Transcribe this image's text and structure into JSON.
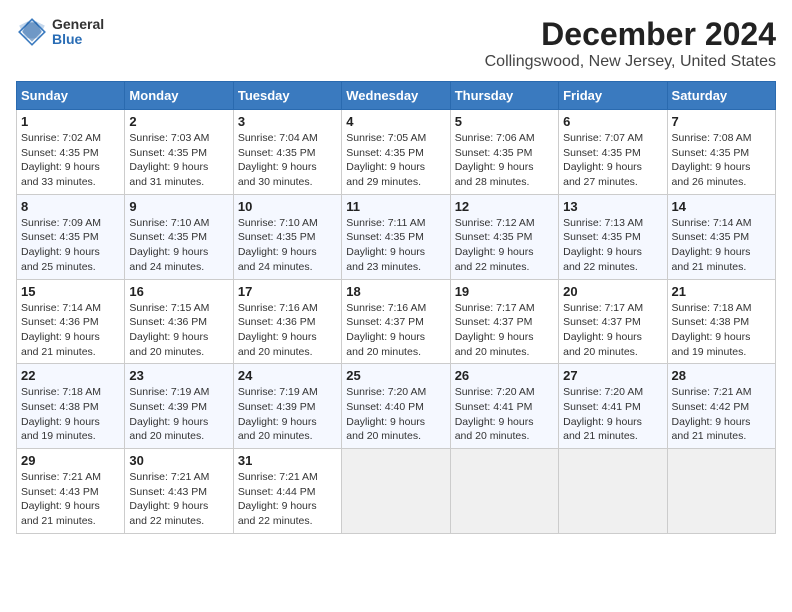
{
  "app": {
    "name": "GeneralBlue",
    "logo_text_line1": "General",
    "logo_text_line2": "Blue"
  },
  "title": "December 2024",
  "subtitle": "Collingswood, New Jersey, United States",
  "calendar": {
    "headers": [
      "Sunday",
      "Monday",
      "Tuesday",
      "Wednesday",
      "Thursday",
      "Friday",
      "Saturday"
    ],
    "weeks": [
      [
        {
          "day": "1",
          "info": "Sunrise: 7:02 AM\nSunset: 4:35 PM\nDaylight: 9 hours\nand 33 minutes."
        },
        {
          "day": "2",
          "info": "Sunrise: 7:03 AM\nSunset: 4:35 PM\nDaylight: 9 hours\nand 31 minutes."
        },
        {
          "day": "3",
          "info": "Sunrise: 7:04 AM\nSunset: 4:35 PM\nDaylight: 9 hours\nand 30 minutes."
        },
        {
          "day": "4",
          "info": "Sunrise: 7:05 AM\nSunset: 4:35 PM\nDaylight: 9 hours\nand 29 minutes."
        },
        {
          "day": "5",
          "info": "Sunrise: 7:06 AM\nSunset: 4:35 PM\nDaylight: 9 hours\nand 28 minutes."
        },
        {
          "day": "6",
          "info": "Sunrise: 7:07 AM\nSunset: 4:35 PM\nDaylight: 9 hours\nand 27 minutes."
        },
        {
          "day": "7",
          "info": "Sunrise: 7:08 AM\nSunset: 4:35 PM\nDaylight: 9 hours\nand 26 minutes."
        }
      ],
      [
        {
          "day": "8",
          "info": "Sunrise: 7:09 AM\nSunset: 4:35 PM\nDaylight: 9 hours\nand 25 minutes."
        },
        {
          "day": "9",
          "info": "Sunrise: 7:10 AM\nSunset: 4:35 PM\nDaylight: 9 hours\nand 24 minutes."
        },
        {
          "day": "10",
          "info": "Sunrise: 7:10 AM\nSunset: 4:35 PM\nDaylight: 9 hours\nand 24 minutes."
        },
        {
          "day": "11",
          "info": "Sunrise: 7:11 AM\nSunset: 4:35 PM\nDaylight: 9 hours\nand 23 minutes."
        },
        {
          "day": "12",
          "info": "Sunrise: 7:12 AM\nSunset: 4:35 PM\nDaylight: 9 hours\nand 22 minutes."
        },
        {
          "day": "13",
          "info": "Sunrise: 7:13 AM\nSunset: 4:35 PM\nDaylight: 9 hours\nand 22 minutes."
        },
        {
          "day": "14",
          "info": "Sunrise: 7:14 AM\nSunset: 4:35 PM\nDaylight: 9 hours\nand 21 minutes."
        }
      ],
      [
        {
          "day": "15",
          "info": "Sunrise: 7:14 AM\nSunset: 4:36 PM\nDaylight: 9 hours\nand 21 minutes."
        },
        {
          "day": "16",
          "info": "Sunrise: 7:15 AM\nSunset: 4:36 PM\nDaylight: 9 hours\nand 20 minutes."
        },
        {
          "day": "17",
          "info": "Sunrise: 7:16 AM\nSunset: 4:36 PM\nDaylight: 9 hours\nand 20 minutes."
        },
        {
          "day": "18",
          "info": "Sunrise: 7:16 AM\nSunset: 4:37 PM\nDaylight: 9 hours\nand 20 minutes."
        },
        {
          "day": "19",
          "info": "Sunrise: 7:17 AM\nSunset: 4:37 PM\nDaylight: 9 hours\nand 20 minutes."
        },
        {
          "day": "20",
          "info": "Sunrise: 7:17 AM\nSunset: 4:37 PM\nDaylight: 9 hours\nand 20 minutes."
        },
        {
          "day": "21",
          "info": "Sunrise: 7:18 AM\nSunset: 4:38 PM\nDaylight: 9 hours\nand 19 minutes."
        }
      ],
      [
        {
          "day": "22",
          "info": "Sunrise: 7:18 AM\nSunset: 4:38 PM\nDaylight: 9 hours\nand 19 minutes."
        },
        {
          "day": "23",
          "info": "Sunrise: 7:19 AM\nSunset: 4:39 PM\nDaylight: 9 hours\nand 20 minutes."
        },
        {
          "day": "24",
          "info": "Sunrise: 7:19 AM\nSunset: 4:39 PM\nDaylight: 9 hours\nand 20 minutes."
        },
        {
          "day": "25",
          "info": "Sunrise: 7:20 AM\nSunset: 4:40 PM\nDaylight: 9 hours\nand 20 minutes."
        },
        {
          "day": "26",
          "info": "Sunrise: 7:20 AM\nSunset: 4:41 PM\nDaylight: 9 hours\nand 20 minutes."
        },
        {
          "day": "27",
          "info": "Sunrise: 7:20 AM\nSunset: 4:41 PM\nDaylight: 9 hours\nand 21 minutes."
        },
        {
          "day": "28",
          "info": "Sunrise: 7:21 AM\nSunset: 4:42 PM\nDaylight: 9 hours\nand 21 minutes."
        }
      ],
      [
        {
          "day": "29",
          "info": "Sunrise: 7:21 AM\nSunset: 4:43 PM\nDaylight: 9 hours\nand 21 minutes."
        },
        {
          "day": "30",
          "info": "Sunrise: 7:21 AM\nSunset: 4:43 PM\nDaylight: 9 hours\nand 22 minutes."
        },
        {
          "day": "31",
          "info": "Sunrise: 7:21 AM\nSunset: 4:44 PM\nDaylight: 9 hours\nand 22 minutes."
        },
        {
          "day": "",
          "info": ""
        },
        {
          "day": "",
          "info": ""
        },
        {
          "day": "",
          "info": ""
        },
        {
          "day": "",
          "info": ""
        }
      ]
    ]
  }
}
